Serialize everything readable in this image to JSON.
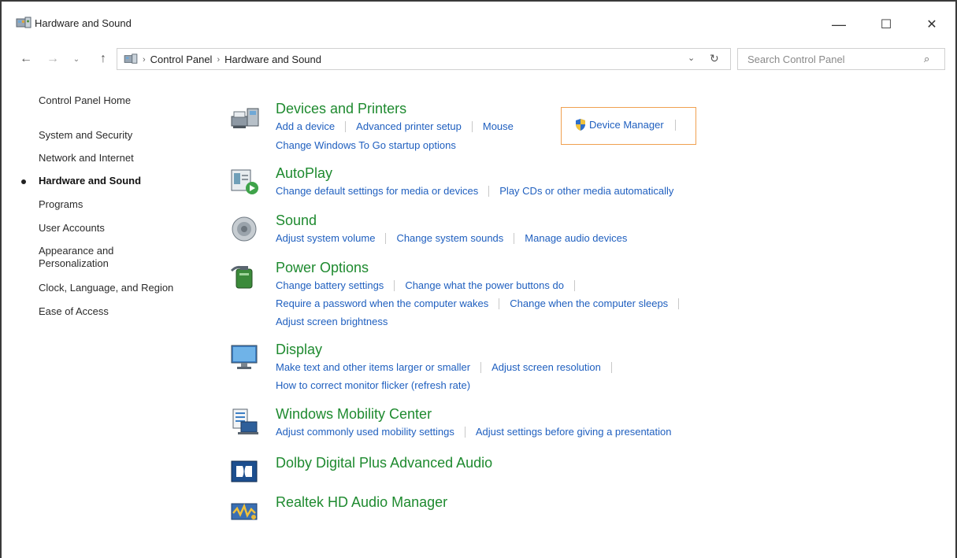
{
  "window": {
    "title": "Hardware and Sound",
    "minimize_glyph": "—",
    "maximize_glyph": "☐",
    "close_glyph": "✕"
  },
  "nav": {
    "back_glyph": "←",
    "forward_glyph": "→",
    "recent_glyph": "⌄",
    "up_glyph": "↑",
    "breadcrumb": [
      "Control Panel",
      "Hardware and Sound"
    ],
    "breadcrumb_sep": "›",
    "dropdown_glyph": "⌄",
    "refresh_glyph": "↻",
    "search_placeholder": "Search Control Panel",
    "search_glyph": "⌕"
  },
  "sidebar": {
    "items": [
      {
        "label": "Control Panel Home"
      },
      {
        "label": "System and Security"
      },
      {
        "label": "Network and Internet"
      },
      {
        "label": "Hardware and Sound",
        "active": true
      },
      {
        "label": "Programs"
      },
      {
        "label": "User Accounts"
      },
      {
        "label": "Appearance and",
        "label2": "Personalization"
      },
      {
        "label": "Clock, Language, and Region"
      },
      {
        "label": "Ease of Access"
      }
    ]
  },
  "categories": {
    "devices": {
      "title": "Devices and Printers",
      "add_device": "Add a device",
      "advanced_printer": "Advanced printer setup",
      "mouse": "Mouse",
      "device_manager": "Device Manager",
      "windows_to_go": "Change Windows To Go startup options"
    },
    "autoplay": {
      "title": "AutoPlay",
      "change_default": "Change default settings for media or devices",
      "play_cds": "Play CDs or other media automatically"
    },
    "sound": {
      "title": "Sound",
      "adjust_volume": "Adjust system volume",
      "change_sounds": "Change system sounds",
      "manage_audio": "Manage audio devices"
    },
    "power": {
      "title": "Power Options",
      "battery": "Change battery settings",
      "power_buttons": "Change what the power buttons do",
      "require_password": "Require a password when the computer wakes",
      "sleeps": "Change when the computer sleeps",
      "brightness": "Adjust screen brightness"
    },
    "display": {
      "title": "Display",
      "text_larger": "Make text and other items larger or smaller",
      "resolution": "Adjust screen resolution",
      "flicker": "How to correct monitor flicker (refresh rate)"
    },
    "mobility": {
      "title": "Windows Mobility Center",
      "mobility_settings": "Adjust commonly used mobility settings",
      "presentation": "Adjust settings before giving a presentation"
    },
    "dolby": {
      "title": "Dolby Digital Plus Advanced Audio"
    },
    "realtek": {
      "title": "Realtek HD Audio Manager"
    }
  },
  "colors": {
    "title_green": "#1e8a2f",
    "link_blue": "#1f5fbf",
    "highlight_orange": "#f0a050"
  }
}
